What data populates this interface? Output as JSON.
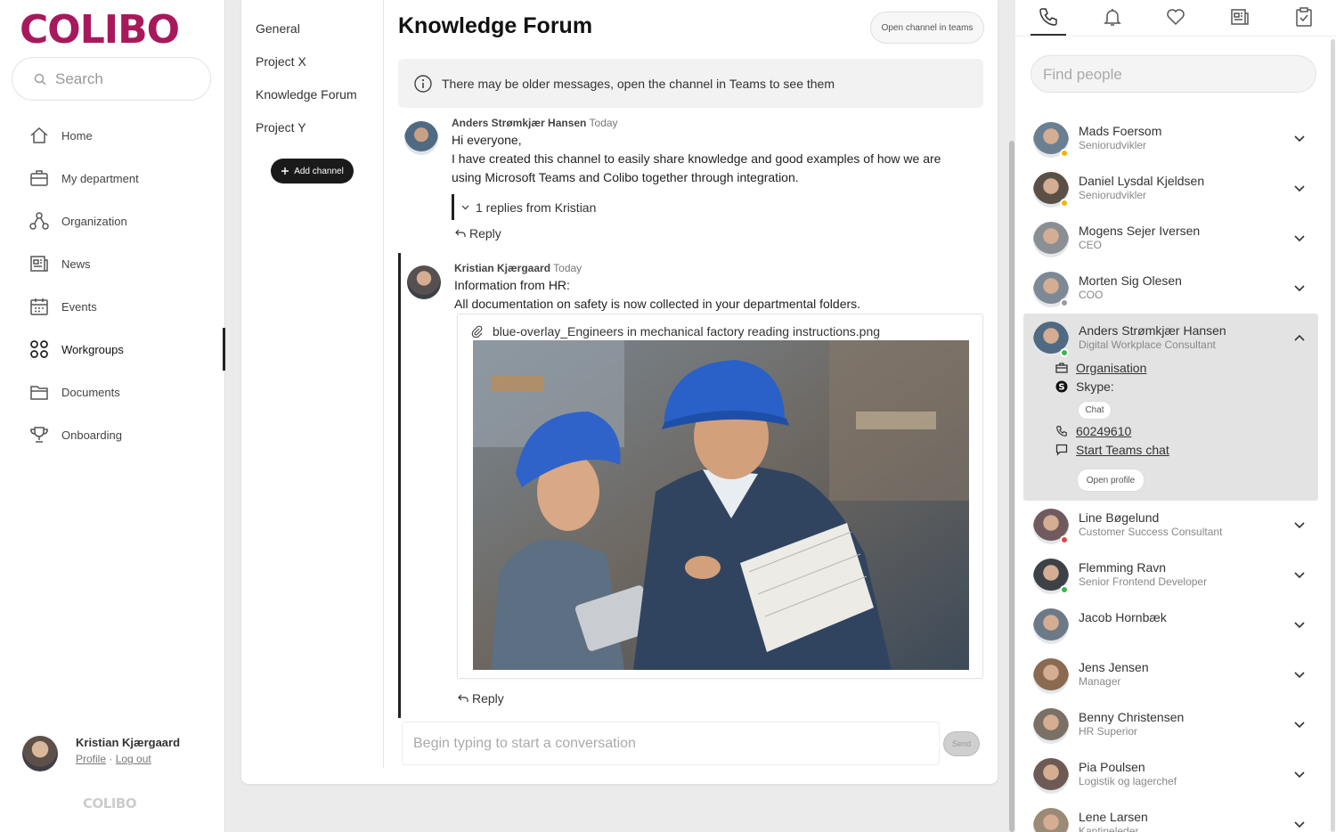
{
  "brand": {
    "logo": "COLIBO",
    "footer_logo": "COLIBO",
    "accent": "#a8195c"
  },
  "search": {
    "placeholder": "Search"
  },
  "nav": {
    "items": [
      {
        "label": "Home",
        "icon": "home-icon"
      },
      {
        "label": "My department",
        "icon": "briefcase-icon"
      },
      {
        "label": "Organization",
        "icon": "org-icon"
      },
      {
        "label": "News",
        "icon": "news-icon"
      },
      {
        "label": "Events",
        "icon": "calendar-icon"
      },
      {
        "label": "Workgroups",
        "icon": "workgroups-icon",
        "active": true
      },
      {
        "label": "Documents",
        "icon": "folder-icon"
      },
      {
        "label": "Onboarding",
        "icon": "trophy-icon"
      }
    ]
  },
  "user": {
    "name": "Kristian Kjærgaard",
    "profile_link": "Profile",
    "separator": "·",
    "logout_link": "Log out"
  },
  "channels": {
    "items": [
      "General",
      "Project X",
      "Knowledge Forum",
      "Project Y"
    ],
    "add_label": "Add channel"
  },
  "forum": {
    "title": "Knowledge Forum",
    "open_teams": "Open channel in teams",
    "notice": "There may be older messages, open the channel in Teams to see them"
  },
  "messages": [
    {
      "author": "Anders Strømkjær Hansen",
      "time": "Today",
      "lines": [
        "Hi everyone,",
        "I have created this channel to easily share knowledge and good examples of how we are",
        "using Microsoft Teams and Colibo together through integration."
      ],
      "replies": "1 replies from Kristian",
      "reply_label": "Reply"
    },
    {
      "author": "Kristian Kjærgaard",
      "time": "Today",
      "lines": [
        "Information from HR:",
        "All documentation on safety is now collected in your departmental folders."
      ],
      "attachment": "blue-overlay_Engineers in mechanical factory reading instructions.png",
      "reply_label": "Reply"
    }
  ],
  "compose": {
    "placeholder": "Begin typing to start a conversation",
    "send": "Send"
  },
  "right": {
    "tabs": [
      "phone-icon",
      "bell-icon",
      "heart-icon",
      "newspaper-icon",
      "clipboard-icon"
    ],
    "find_placeholder": "Find people",
    "people": [
      {
        "name": "Mads Foersom",
        "title": "Seniorudvikler",
        "status": "#f2b400"
      },
      {
        "name": "Daniel Lysdal Kjeldsen",
        "title": "Seniorudvikler",
        "status": "#f2b400"
      },
      {
        "name": "Mogens Sejer Iversen",
        "title": "CEO",
        "status": ""
      },
      {
        "name": "Morten Sig Olesen",
        "title": "COO",
        "status": "#9a9a9a"
      },
      {
        "name": "Anders Strømkjær Hansen",
        "title": "Digital Workplace Consultant",
        "status": "#3cb54a",
        "expanded": true
      },
      {
        "name": "Line Bøgelund",
        "title": "Customer Success Consultant",
        "status": "#d94848"
      },
      {
        "name": "Flemming Ravn",
        "title": "Senior Frontend Developer",
        "status": "#3cb54a"
      },
      {
        "name": "Jacob Hornbæk",
        "title": "",
        "status": ""
      },
      {
        "name": "Jens Jensen",
        "title": "Manager",
        "status": ""
      },
      {
        "name": "Benny Christensen",
        "title": "HR Superior",
        "status": ""
      },
      {
        "name": "Pia Poulsen",
        "title": "Logistik og lagerchef",
        "status": ""
      },
      {
        "name": "Lene Larsen",
        "title": "Kantineleder",
        "status": ""
      }
    ],
    "expanded": {
      "organisation": "Organisation",
      "skype_label": "Skype:",
      "chat": "Chat",
      "phone": "60249610",
      "teams_chat": "Start Teams chat",
      "open_profile": "Open profile"
    }
  }
}
